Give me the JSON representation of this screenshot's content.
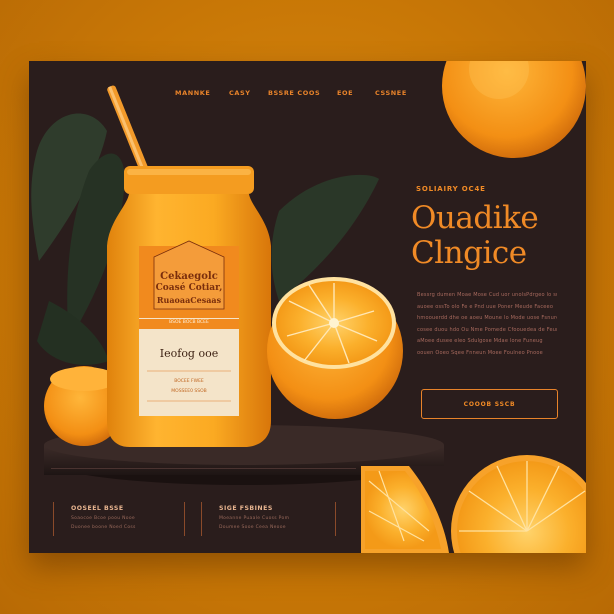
{
  "nav": {
    "items": [
      "MANNKE",
      "CASY",
      "BSSRE COOS",
      "EOE",
      "CSSNEE"
    ]
  },
  "hero": {
    "eyebrow": "SOLIAIRY OC4E",
    "headline": [
      "Ouadike",
      "Clngice"
    ],
    "body_lines": [
      "Bessrg dumen Moae Mose Cud uor unolsPdrgeo lo suner",
      "auoee ossTo olo Fe e Pnd uue Poner Meude Faceeo",
      "hmoouerdd dhe oe aoeu Moune lo Mode uose Fsnure",
      "cosee duou hdo Ou Nme Pomede Cfoouedea de Feumo",
      "aMoee dusee eleo Sdulgose Mdae lone Funeug",
      "oouen Ooeo Sqee Fnneun Moee Foulneo Pnooe"
    ],
    "cta_label": "COOOB SSCB"
  },
  "product": {
    "label_line1": "Cekaegolc",
    "label_line2": "Coasé Cotiar,",
    "label_line3": "RuaoaaCesaas",
    "label_small": "BSOE BOCB BCEE",
    "label_name": "Ieofog ooe",
    "label_foot1": "BOCEE FWEE",
    "label_foot2": "MOSSEE0 SSOB"
  },
  "footer": {
    "col1": {
      "title": "OOSEEL BSSE",
      "lines": [
        "Soaocoe Bcoe poou Nooe",
        "Duonee boone Noed Coss"
      ]
    },
    "col2": {
      "title": "SIGE FSBINES",
      "lines": [
        "Moeanne Puaale Cuoss Pom",
        "Doumee Sooe Ceea Neooe"
      ]
    }
  },
  "colors": {
    "background": "#c87706",
    "panel": "#2a1d1c",
    "accent": "#f08a26",
    "orange_fruit": "#f59a1e",
    "leaf": "#2f3c2c"
  },
  "icons": [
    "orange-slice-icon",
    "leaf-icon",
    "straw-icon",
    "jar-icon"
  ]
}
